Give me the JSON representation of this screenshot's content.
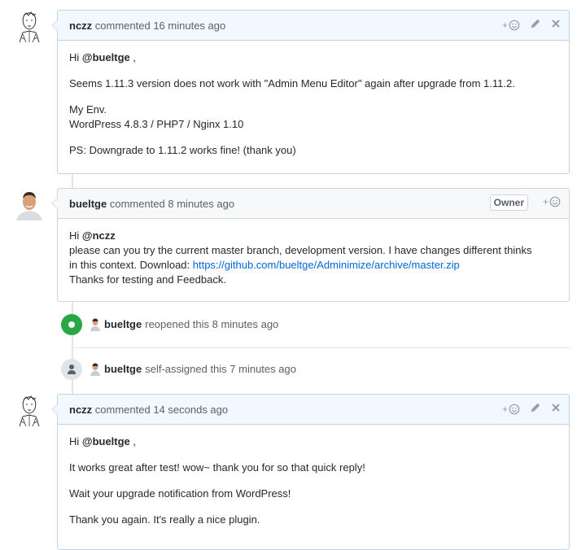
{
  "comments": [
    {
      "author": "nczz",
      "meta": "commented 16 minutes ago",
      "lines": [
        {
          "pre": "Hi ",
          "mention": "@bueltge",
          "post": " ,"
        },
        "Seems 1.11.3 version does not work with \"Admin Menu Editor\" again after upgrade from 1.11.2.",
        [
          "My Env.",
          "WordPress 4.8.3 / PHP7 / Nginx 1.10"
        ],
        "PS: Downgrade to 1.11.2 works fine! (thank you)"
      ]
    },
    {
      "author": "bueltge",
      "meta": "commented 8 minutes ago",
      "badge": "Owner",
      "greeting_pre": "Hi ",
      "greeting_mention": "@nczz",
      "line1": "please can you try the current master branch, development version. I have changes different thinks",
      "line2_pre": "in this context. Download: ",
      "link": "https://github.com/bueltge/Adminimize/archive/master.zip",
      "line3": "Thanks for testing and Feedback."
    },
    {
      "author": "nczz",
      "meta": "commented 14 seconds ago",
      "lines": [
        {
          "pre": "Hi ",
          "mention": "@bueltge",
          "post": " ,"
        },
        "It works great after test! wow~ thank you for so that quick reply!",
        "Wait your upgrade notification from WordPress!",
        "Thank you again. It's really a nice plugin."
      ]
    }
  ],
  "events": [
    {
      "actor": "bueltge",
      "text": "reopened this 8 minutes ago"
    },
    {
      "actor": "bueltge",
      "text": "self-assigned this 7 minutes ago"
    }
  ],
  "colors": {
    "open_badge": "#28a745",
    "link": "#0366d6",
    "own_header": "#f1f8ff"
  },
  "icons": [
    "smiley-icon",
    "pencil-icon",
    "close-icon",
    "open-dot-icon",
    "person-icon"
  ]
}
